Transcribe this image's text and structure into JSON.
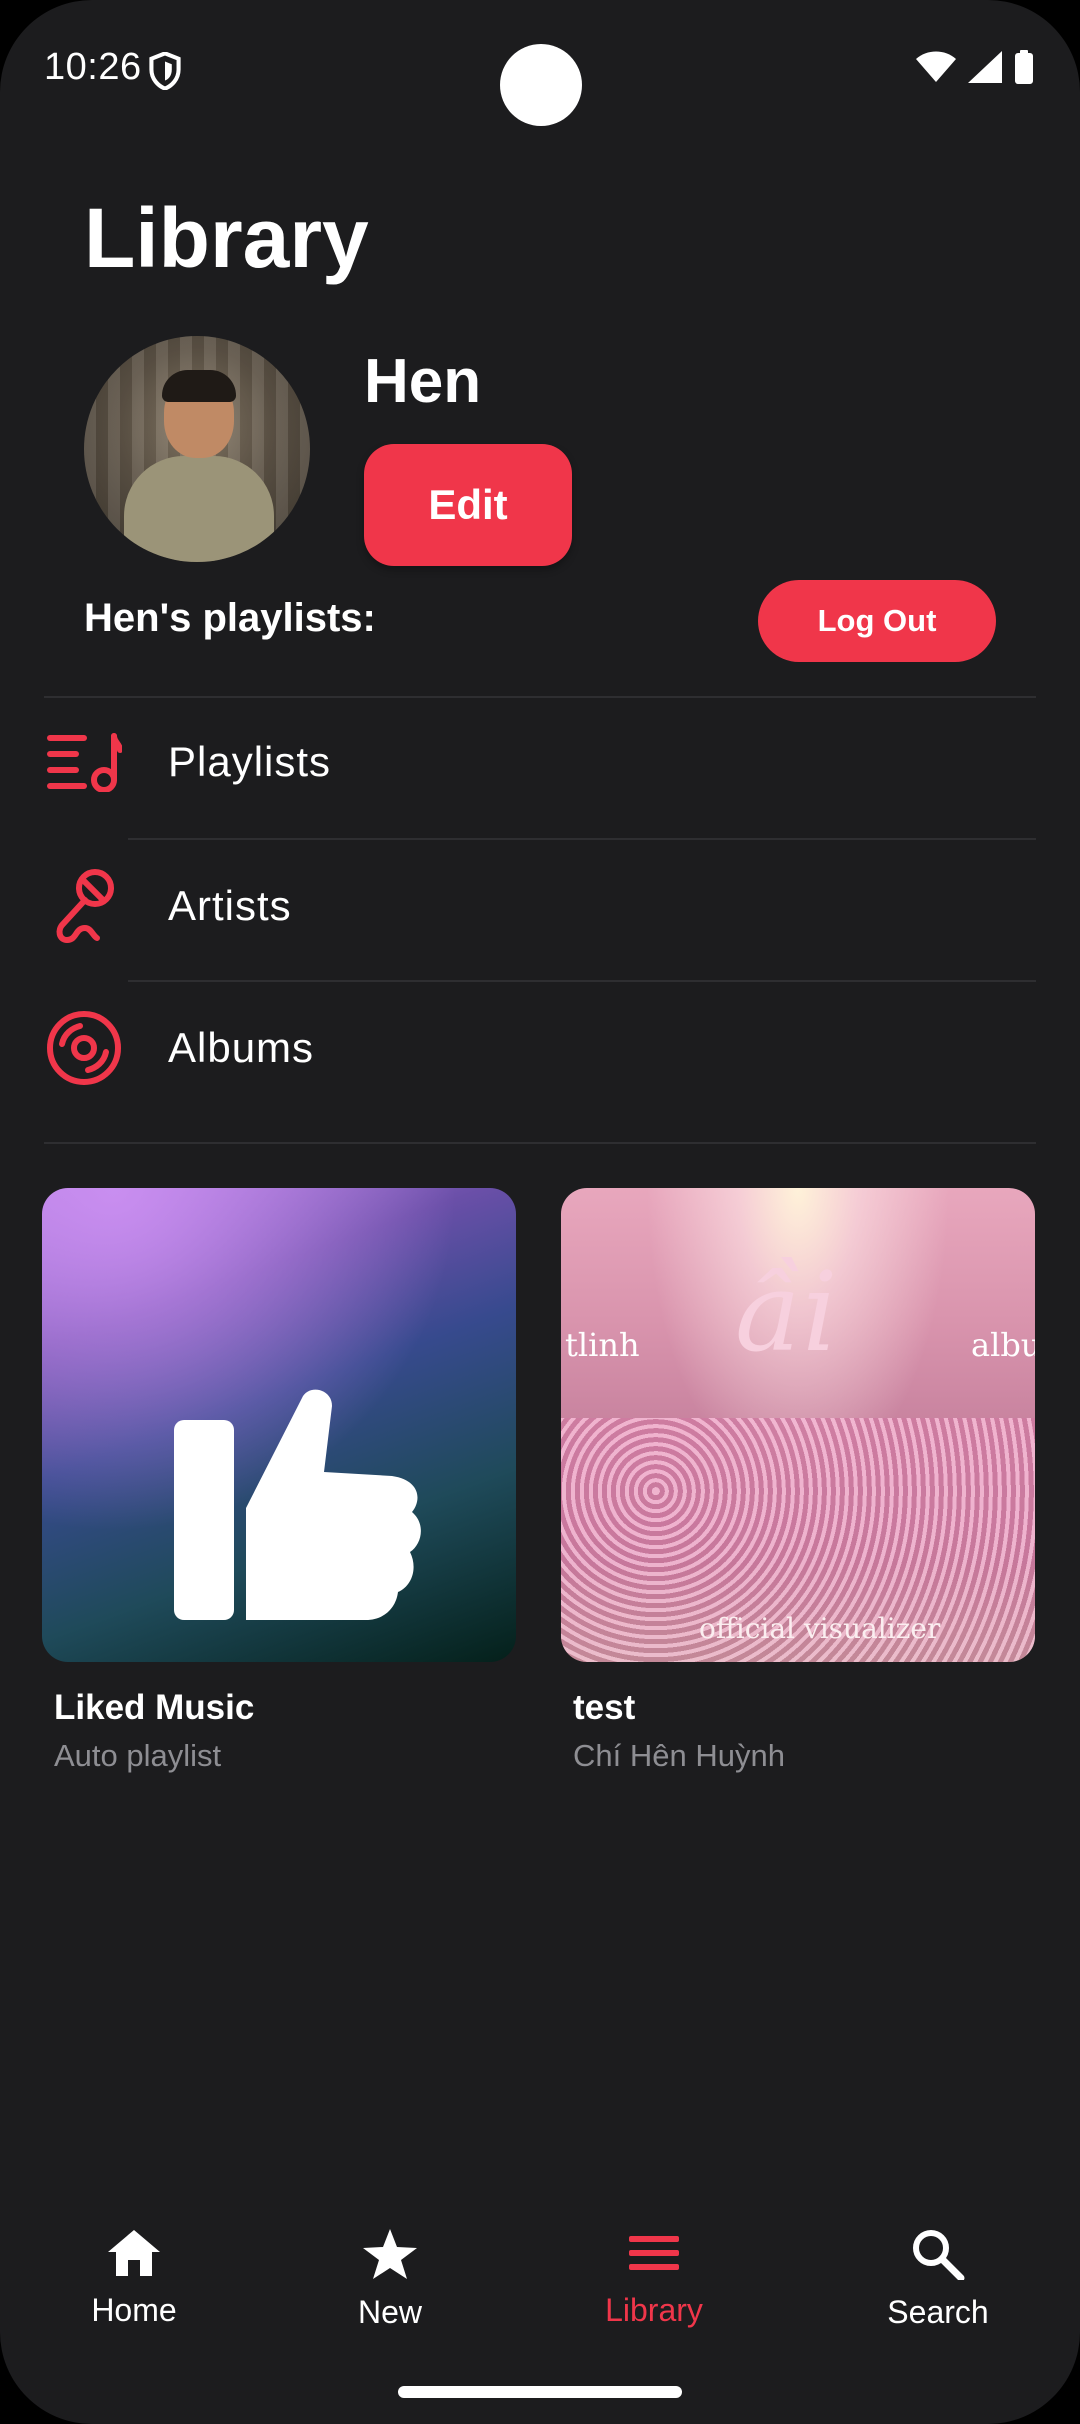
{
  "status_bar": {
    "time": "10:26"
  },
  "header": {
    "title": "Library"
  },
  "profile": {
    "name": "Hen",
    "edit_label": "Edit",
    "playlists_heading": "Hen's playlists:",
    "logout_label": "Log Out"
  },
  "menu": {
    "items": [
      {
        "label": "Playlists",
        "icon": "playlist-icon"
      },
      {
        "label": "Artists",
        "icon": "microphone-icon"
      },
      {
        "label": "Albums",
        "icon": "vinyl-icon"
      }
    ]
  },
  "cards": [
    {
      "title": "Liked Music",
      "subtitle": "Auto playlist",
      "art": "thumbs-up-icon"
    },
    {
      "title": "test",
      "subtitle": "Chí Hên Huỳnh",
      "art_texts": {
        "left": "tlinh",
        "center": "ầi",
        "right": "albu",
        "bottom": "official visualizer"
      }
    }
  ],
  "bottom_nav": {
    "items": [
      {
        "label": "Home",
        "icon": "home-icon"
      },
      {
        "label": "New",
        "icon": "star-icon"
      },
      {
        "label": "Library",
        "icon": "menu-icon"
      },
      {
        "label": "Search",
        "icon": "search-icon"
      }
    ],
    "active": "Library"
  },
  "colors": {
    "accent": "#f0364a",
    "background": "#1c1c1e",
    "secondary_text": "#8e8e93"
  }
}
